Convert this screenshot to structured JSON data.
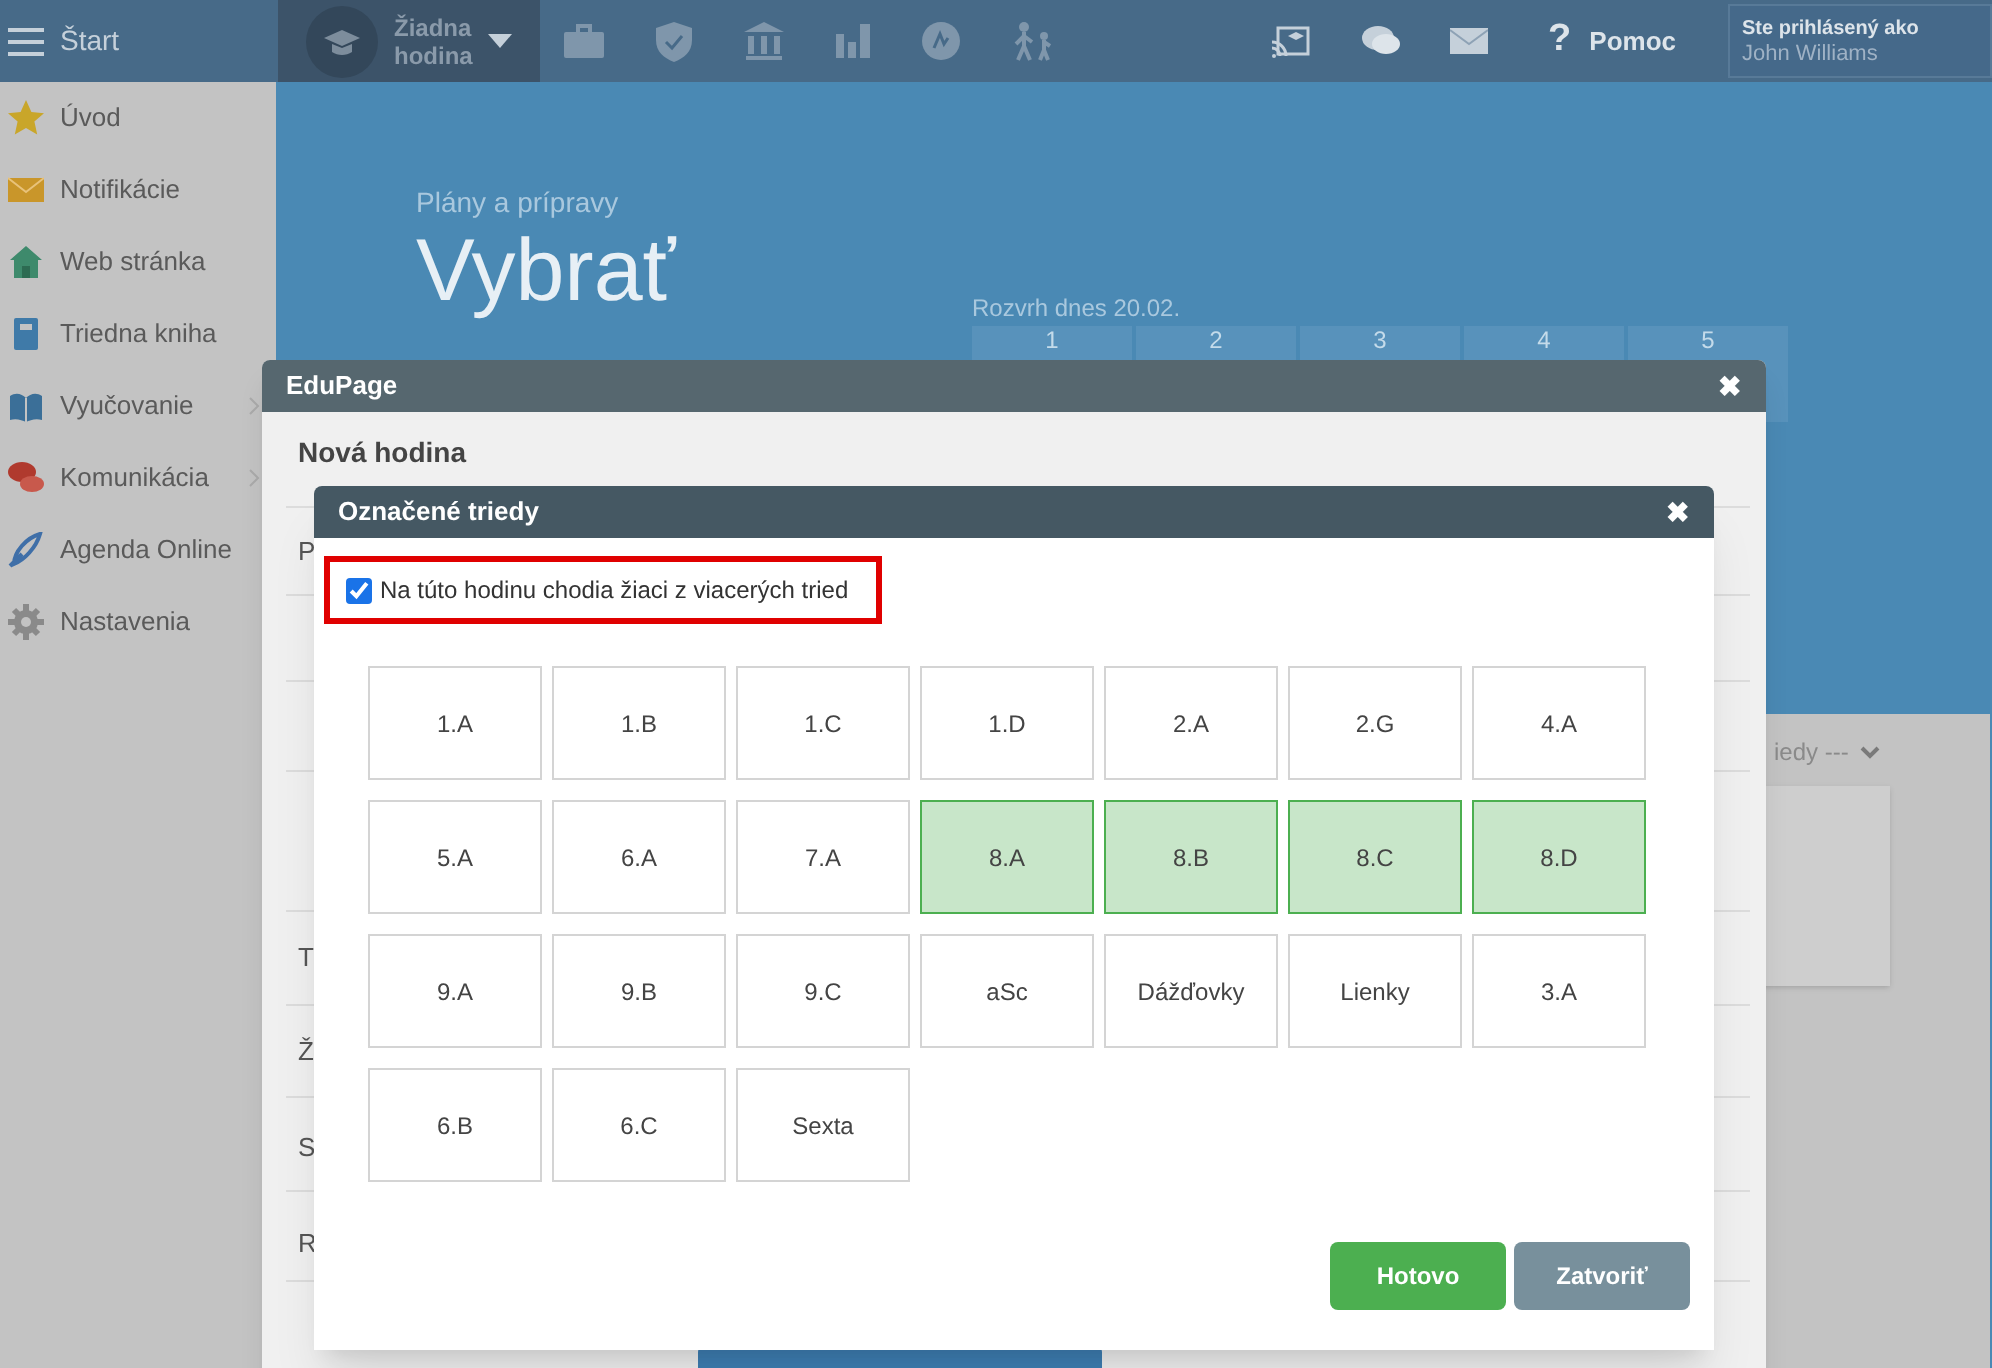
{
  "topbar": {
    "menu_label": "Štart",
    "lesson": {
      "lines": [
        "Žiadna",
        "hodina"
      ]
    },
    "help_icon": "?",
    "help": "Pomoc",
    "user": {
      "caption": "Ste prihlásený ako",
      "name": "John Williams"
    }
  },
  "sidebar": {
    "items": [
      {
        "label": "Úvod",
        "submenu": false
      },
      {
        "label": "Notifikácie",
        "submenu": false
      },
      {
        "label": "Web stránka",
        "submenu": false
      },
      {
        "label": "Triedna kniha",
        "submenu": false
      },
      {
        "label": "Vyučovanie",
        "submenu": true
      },
      {
        "label": "Komunikácia",
        "submenu": true
      },
      {
        "label": "Agenda Online",
        "submenu": false
      },
      {
        "label": "Nastavenia",
        "submenu": false
      }
    ]
  },
  "page": {
    "subtitle": "Plány a prípravy",
    "title": "Vybrať",
    "timetable": {
      "caption": "Rozvrh dnes 20.02.",
      "periods": [
        "1",
        "2",
        "3",
        "4",
        "5"
      ]
    },
    "filter_fragment": "iedy ---"
  },
  "lesson_dialog": {
    "title": "EduPage",
    "close": "✖",
    "heading": "Nová hodina",
    "row_labels": [
      "P",
      "T",
      "Ž",
      "S",
      "R"
    ]
  },
  "classes_dialog": {
    "title": "Označené triedy",
    "close": "✖",
    "multi_class": {
      "label": "Na túto hodinu chodia žiaci z viacerých tried",
      "checked": true
    },
    "classes": [
      {
        "label": "1.A",
        "selected": false
      },
      {
        "label": "1.B",
        "selected": false
      },
      {
        "label": "1.C",
        "selected": false
      },
      {
        "label": "1.D",
        "selected": false
      },
      {
        "label": "2.A",
        "selected": false
      },
      {
        "label": "2.G",
        "selected": false
      },
      {
        "label": "4.A",
        "selected": false
      },
      {
        "label": "5.A",
        "selected": false
      },
      {
        "label": "6.A",
        "selected": false
      },
      {
        "label": "7.A",
        "selected": false
      },
      {
        "label": "8.A",
        "selected": true
      },
      {
        "label": "8.B",
        "selected": true
      },
      {
        "label": "8.C",
        "selected": true
      },
      {
        "label": "8.D",
        "selected": true
      },
      {
        "label": "9.A",
        "selected": false
      },
      {
        "label": "9.B",
        "selected": false
      },
      {
        "label": "9.C",
        "selected": false
      },
      {
        "label": "aSc",
        "selected": false
      },
      {
        "label": "Dážďovky",
        "selected": false
      },
      {
        "label": "Lienky",
        "selected": false
      },
      {
        "label": "3.A",
        "selected": false
      },
      {
        "label": "6.B",
        "selected": false
      },
      {
        "label": "6.C",
        "selected": false
      },
      {
        "label": "Sexta",
        "selected": false
      }
    ],
    "buttons": [
      {
        "label": "Hotovo",
        "kind": "primary"
      },
      {
        "label": "Zatvoriť",
        "kind": "secondary"
      }
    ]
  }
}
